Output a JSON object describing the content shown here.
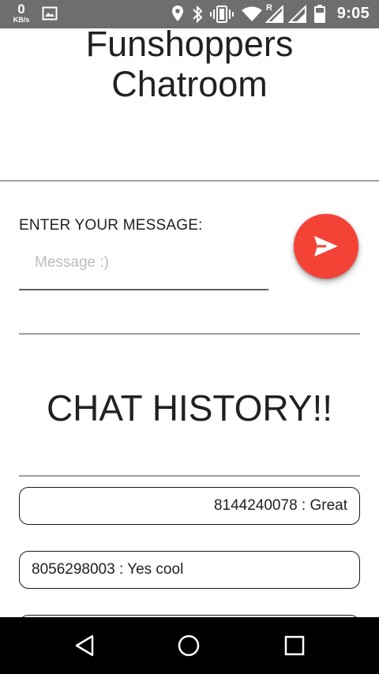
{
  "status_bar": {
    "speed_value": "0",
    "speed_unit": "KB/s",
    "roaming_indicator": "R",
    "time": "9:05",
    "icons": [
      "image-icon",
      "location-icon",
      "bluetooth-icon",
      "vibrate-icon",
      "wifi-icon",
      "signal-icon",
      "signal-icon",
      "battery-icon"
    ]
  },
  "header": {
    "title": "Funshoppers Chatroom"
  },
  "composer": {
    "label": "ENTER YOUR MESSAGE:",
    "placeholder": "Message :)",
    "value": "",
    "send_icon": "send-icon"
  },
  "history": {
    "title": "CHAT HISTORY!!",
    "messages": [
      {
        "text": "8144240078 : Great",
        "align": "right"
      },
      {
        "text": "8056298003 : Yes cool",
        "align": "left"
      },
      {
        "text": "",
        "align": "left"
      }
    ]
  },
  "nav_bar": {
    "buttons": [
      "back-icon",
      "home-icon",
      "recents-icon"
    ]
  },
  "colors": {
    "accent": "#f44336",
    "status_bar": "#6e6e6e",
    "nav_bar": "#000000",
    "text": "#212121"
  }
}
